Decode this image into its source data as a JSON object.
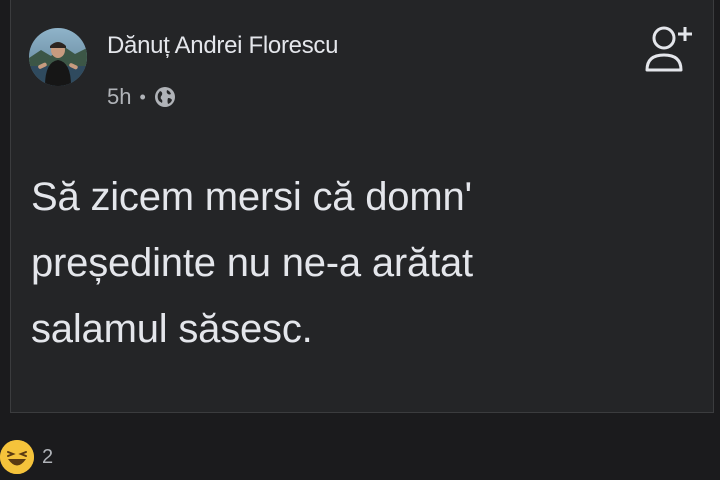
{
  "post": {
    "author": "Dănuț Andrei Florescu",
    "timestamp": "5h",
    "separator": "•",
    "privacy_icon": "globe-icon",
    "text_lines": [
      "Să zicem mersi că domn'",
      "președinte nu ne-a arătat",
      "salamul săsesc."
    ]
  },
  "actions": {
    "add_friend_icon": "add-friend-icon"
  },
  "reactions": {
    "icon": "haha-reaction-icon",
    "count": "2"
  },
  "colors": {
    "background": "#1b1b1d",
    "card": "#242527",
    "text_primary": "#e4e6eb",
    "text_secondary": "#b0b3b8"
  }
}
